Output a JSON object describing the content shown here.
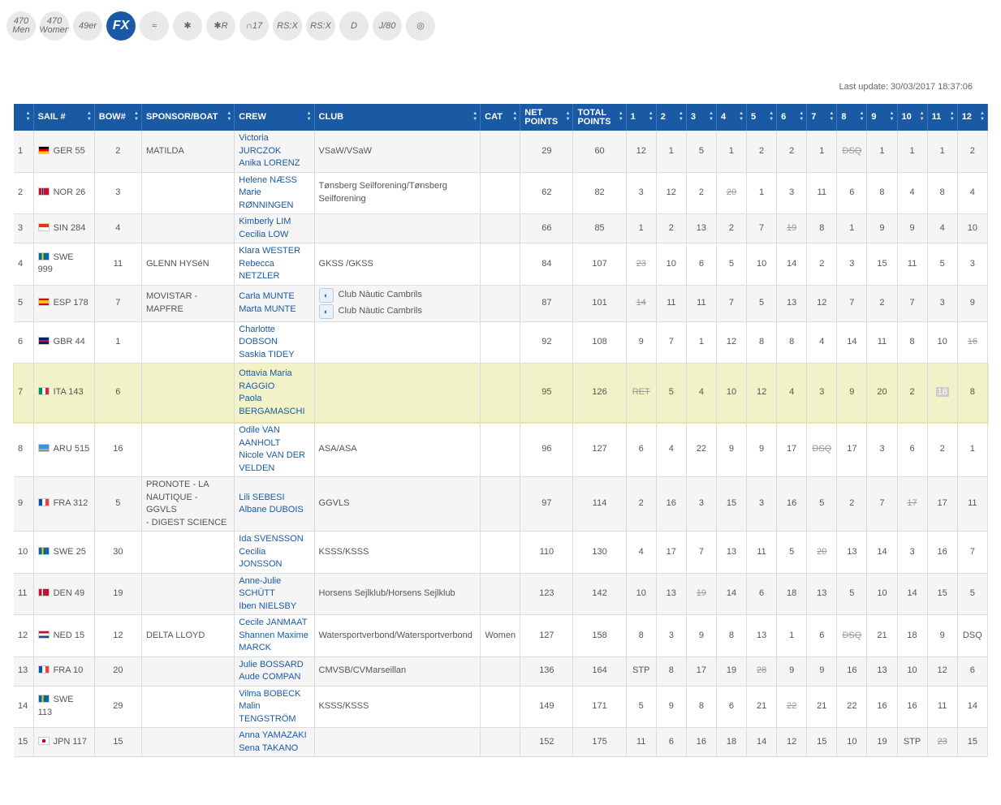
{
  "class_icons": [
    {
      "name": "470-men-icon",
      "label": "470 Men"
    },
    {
      "name": "470-women-icon",
      "label": "470 Women"
    },
    {
      "name": "49er-icon",
      "label": "49er"
    },
    {
      "name": "fx-icon",
      "label": "FX",
      "active": true
    },
    {
      "name": "nacra-icon",
      "label": "≈"
    },
    {
      "name": "finn-icon",
      "label": "✱"
    },
    {
      "name": "laser-radial-icon",
      "label": "✱R"
    },
    {
      "name": "2-4mr-icon",
      "label": "∩17"
    },
    {
      "name": "rsx-men-icon",
      "label": "RS:X"
    },
    {
      "name": "rsx-women-icon",
      "label": "RS:X"
    },
    {
      "name": "2-4-icon",
      "label": "D"
    },
    {
      "name": "j80-icon",
      "label": "J/80"
    },
    {
      "name": "globe-icon",
      "label": "◎"
    }
  ],
  "last_update": "Last update: 30/03/2017 18:37:06",
  "columns": [
    "",
    "SAIL #",
    "BOW#",
    "SPONSOR/BOAT",
    "CREW",
    "CLUB",
    "CAT",
    "NET POINTS",
    "TOTAL POINTS",
    "1",
    "2",
    "3",
    "4",
    "5",
    "6",
    "7",
    "8",
    "9",
    "10",
    "11",
    "12"
  ],
  "rows": [
    {
      "rank": "1",
      "flag": "GER",
      "sail": "GER 55",
      "bow": "2",
      "sponsor": [
        "MATILDA"
      ],
      "crew": [
        "Victoria",
        "JURCZOK",
        "Anika LORENZ"
      ],
      "club": [
        "VSaW/VSaW"
      ],
      "cat": "",
      "net": "29",
      "total": "60",
      "races": [
        "12",
        "1",
        "5",
        "1",
        "2",
        "2",
        "1",
        "DSQ",
        "1",
        "1",
        "1",
        "2"
      ],
      "discard": [
        7
      ]
    },
    {
      "rank": "2",
      "flag": "NOR",
      "sail": "NOR 26",
      "bow": "3",
      "sponsor": [],
      "crew": [
        "Helene NÆSS",
        "Marie",
        "RØNNINGEN"
      ],
      "club": [
        "Tønsberg Seilforening/Tønsberg",
        "Seilforening"
      ],
      "cat": "",
      "net": "62",
      "total": "82",
      "races": [
        "3",
        "12",
        "2",
        "20",
        "1",
        "3",
        "11",
        "6",
        "8",
        "4",
        "8",
        "4"
      ],
      "discard": [
        3
      ]
    },
    {
      "rank": "3",
      "flag": "SIN",
      "sail": "SIN 284",
      "bow": "4",
      "sponsor": [],
      "crew": [
        "Kimberly LIM",
        "Cecilia LOW"
      ],
      "club": [],
      "cat": "",
      "net": "66",
      "total": "85",
      "races": [
        "1",
        "2",
        "13",
        "2",
        "7",
        "19",
        "8",
        "1",
        "9",
        "9",
        "4",
        "10"
      ],
      "discard": [
        5
      ]
    },
    {
      "rank": "4",
      "flag": "SWE",
      "sail": "SWE 999",
      "bow": "11",
      "sponsor": [
        "GLENN HYSéN"
      ],
      "crew": [
        "Klara WESTER",
        "Rebecca",
        "NETZLER"
      ],
      "club": [
        "GKSS /GKSS"
      ],
      "cat": "",
      "net": "84",
      "total": "107",
      "races": [
        "23",
        "10",
        "6",
        "5",
        "10",
        "14",
        "2",
        "3",
        "15",
        "11",
        "5",
        "3"
      ],
      "discard": [
        0
      ]
    },
    {
      "rank": "5",
      "flag": "ESP",
      "sail": "ESP 178",
      "bow": "7",
      "sponsor": [
        "MOVISTAR -",
        "MAPFRE"
      ],
      "crew": [
        "Carla MUNTE",
        "Marta MUNTE"
      ],
      "club": [
        "Club Nàutic Cambrils",
        "Club Nàutic Cambrils"
      ],
      "club_logo": true,
      "cat": "",
      "net": "87",
      "total": "101",
      "races": [
        "14",
        "11",
        "11",
        "7",
        "5",
        "13",
        "12",
        "7",
        "2",
        "7",
        "3",
        "9"
      ],
      "discard": [
        0
      ]
    },
    {
      "rank": "6",
      "flag": "GBR",
      "sail": "GBR 44",
      "bow": "1",
      "sponsor": [],
      "crew": [
        "Charlotte",
        "DOBSON",
        "Saskia TIDEY"
      ],
      "club": [],
      "cat": "",
      "net": "92",
      "total": "108",
      "races": [
        "9",
        "7",
        "1",
        "12",
        "8",
        "8",
        "4",
        "14",
        "11",
        "8",
        "10",
        "16"
      ],
      "discard": [
        11
      ]
    },
    {
      "rank": "7",
      "flag": "ITA",
      "sail": "ITA 143",
      "bow": "6",
      "sponsor": [],
      "crew": [
        "Ottavia Maria",
        "RAGGIO",
        "Paola",
        "BERGAMASCHI"
      ],
      "club": [],
      "cat": "",
      "net": "95",
      "total": "126",
      "races": [
        "RET",
        "5",
        "4",
        "10",
        "12",
        "4",
        "3",
        "9",
        "20",
        "2",
        "18",
        "8"
      ],
      "discard": [
        0,
        10
      ],
      "highlight": true
    },
    {
      "rank": "8",
      "flag": "ARU",
      "sail": "ARU 515",
      "bow": "16",
      "sponsor": [],
      "crew": [
        "Odile VAN",
        "AANHOLT",
        "Nicole VAN DER",
        "VELDEN"
      ],
      "club": [
        "ASA/ASA"
      ],
      "cat": "",
      "net": "96",
      "total": "127",
      "races": [
        "6",
        "4",
        "22",
        "9",
        "9",
        "17",
        "DSQ",
        "17",
        "3",
        "6",
        "2",
        "1"
      ],
      "discard": [
        6
      ]
    },
    {
      "rank": "9",
      "flag": "FRA",
      "sail": "FRA 312",
      "bow": "5",
      "sponsor": [
        "PRONOTE - LA",
        "NAUTIQUE - GGVLS",
        "- DIGEST SCIENCE"
      ],
      "crew": [
        "Lili SEBESI",
        "Albane DUBOIS"
      ],
      "club": [
        "GGVLS"
      ],
      "cat": "",
      "net": "97",
      "total": "114",
      "races": [
        "2",
        "16",
        "3",
        "15",
        "3",
        "16",
        "5",
        "2",
        "7",
        "17",
        "17",
        "11"
      ],
      "discard": [
        9
      ]
    },
    {
      "rank": "10",
      "flag": "SWE",
      "sail": "SWE 25",
      "bow": "30",
      "sponsor": [],
      "crew": [
        "Ida SVENSSON",
        "Cecilia JONSSON"
      ],
      "club": [
        "KSSS/KSSS"
      ],
      "cat": "",
      "net": "110",
      "total": "130",
      "races": [
        "4",
        "17",
        "7",
        "13",
        "11",
        "5",
        "20",
        "13",
        "14",
        "3",
        "16",
        "7"
      ],
      "discard": [
        6
      ]
    },
    {
      "rank": "11",
      "flag": "DEN",
      "sail": "DEN 49",
      "bow": "19",
      "sponsor": [],
      "crew": [
        "Anne-Julie",
        "SCHÜTT",
        "Iben NIELSBY"
      ],
      "club": [
        "Horsens Sejlklub/Horsens Sejlklub"
      ],
      "cat": "",
      "net": "123",
      "total": "142",
      "races": [
        "10",
        "13",
        "19",
        "14",
        "6",
        "18",
        "13",
        "5",
        "10",
        "14",
        "15",
        "5"
      ],
      "discard": [
        2
      ]
    },
    {
      "rank": "12",
      "flag": "NED",
      "sail": "NED 15",
      "bow": "12",
      "sponsor": [
        "DELTA LLOYD"
      ],
      "crew": [
        "Cecile JANMAAT",
        "Shannen Maxime",
        "MARCK"
      ],
      "club": [
        "Watersportverbond/Watersportverbond"
      ],
      "cat": "Women",
      "net": "127",
      "total": "158",
      "races": [
        "8",
        "3",
        "9",
        "8",
        "13",
        "1",
        "6",
        "DSQ",
        "21",
        "18",
        "9",
        "DSQ"
      ],
      "discard": [
        7
      ]
    },
    {
      "rank": "13",
      "flag": "FRA",
      "sail": "FRA 10",
      "bow": "20",
      "sponsor": [],
      "crew": [
        "Julie BOSSARD",
        "Aude COMPAN"
      ],
      "club": [
        "CMVSB/CVMarseillan"
      ],
      "cat": "",
      "net": "136",
      "total": "164",
      "races": [
        "STP",
        "8",
        "17",
        "19",
        "28",
        "9",
        "9",
        "16",
        "13",
        "10",
        "12",
        "6"
      ],
      "discard": [
        4
      ]
    },
    {
      "rank": "14",
      "flag": "SWE",
      "sail": "SWE 113",
      "bow": "29",
      "sponsor": [],
      "crew": [
        "Vilma BOBECK",
        "Malin",
        "TENGSTRÖM"
      ],
      "club": [
        "KSSS/KSSS"
      ],
      "cat": "",
      "net": "149",
      "total": "171",
      "races": [
        "5",
        "9",
        "8",
        "6",
        "21",
        "22",
        "21",
        "22",
        "16",
        "16",
        "11",
        "14"
      ],
      "discard": [
        5
      ]
    },
    {
      "rank": "15",
      "flag": "JPN",
      "sail": "JPN 117",
      "bow": "15",
      "sponsor": [],
      "crew": [
        "Anna YAMAZAKI",
        "Sena TAKANO"
      ],
      "club": [],
      "cat": "",
      "net": "152",
      "total": "175",
      "races": [
        "11",
        "6",
        "16",
        "18",
        "14",
        "12",
        "15",
        "10",
        "19",
        "STP",
        "23",
        "15"
      ],
      "discard": [
        10
      ]
    }
  ]
}
